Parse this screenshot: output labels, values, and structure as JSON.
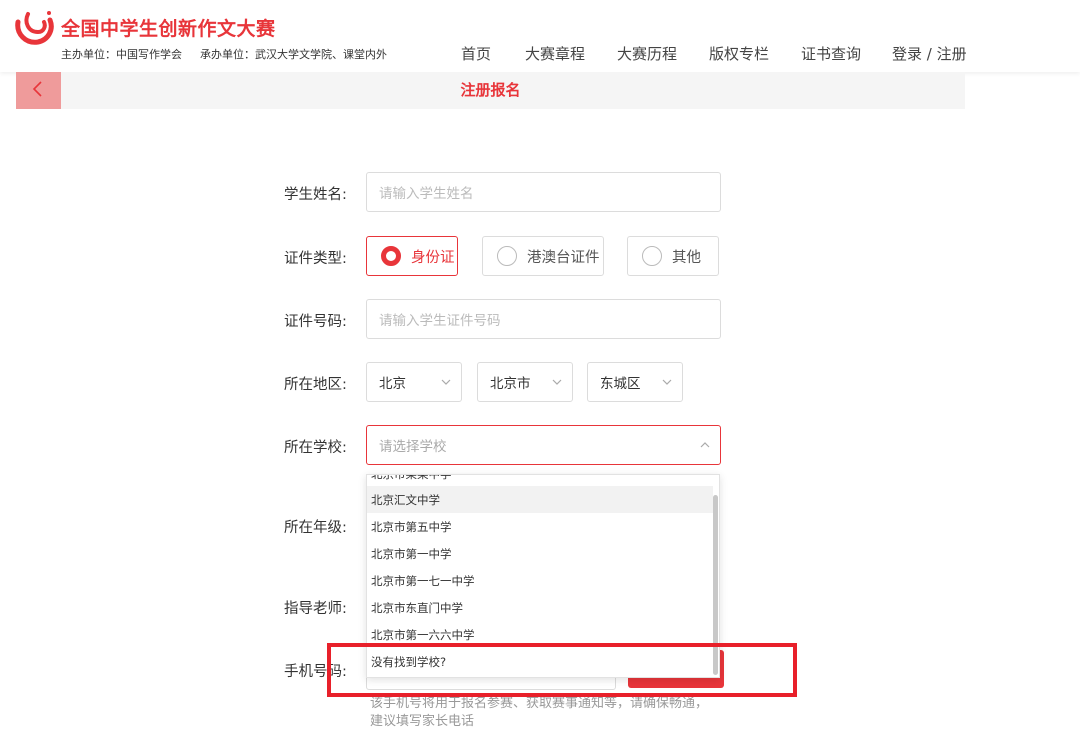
{
  "header": {
    "brand_title": "全国中学生创新作文大赛",
    "host": "主办单位：中国写作学会",
    "organizer": "承办单位：武汉大学文学院、课堂内外",
    "brand_color": "#e8353a",
    "nav": [
      "首页",
      "大赛章程",
      "大赛历程",
      "版权专栏",
      "证书查询",
      "登录 / 注册"
    ]
  },
  "subbar": {
    "back_icon": "chevron-left-icon",
    "title": "注册报名"
  },
  "form": {
    "student_name": {
      "label": "学生姓名:",
      "placeholder": "请输入学生姓名"
    },
    "id_type": {
      "label": "证件类型:",
      "options": [
        "身份证",
        "港澳台证件",
        "其他"
      ],
      "selected": "身份证"
    },
    "id_number": {
      "label": "证件号码:",
      "placeholder": "请输入学生证件号码"
    },
    "region": {
      "label": "所在地区:",
      "province": "北京",
      "city": "北京市",
      "district": "东城区"
    },
    "school": {
      "label": "所在学校:",
      "placeholder": "请选择学校",
      "dropdown_partial": "北京市某某中学",
      "dropdown_items": [
        "北京汇文中学",
        "北京市第五中学",
        "北京市第一中学",
        "北京市第一七一中学",
        "北京市东直门中学",
        "北京市第一六六中学",
        "没有找到学校?"
      ]
    },
    "grade": {
      "label": "所在年级:"
    },
    "teacher": {
      "label": "指导老师:"
    },
    "phone": {
      "label": "手机号码:",
      "hint": "该手机号将用于报名参赛、获取赛事通知等，请确保畅通，建议填写家长电话"
    }
  }
}
